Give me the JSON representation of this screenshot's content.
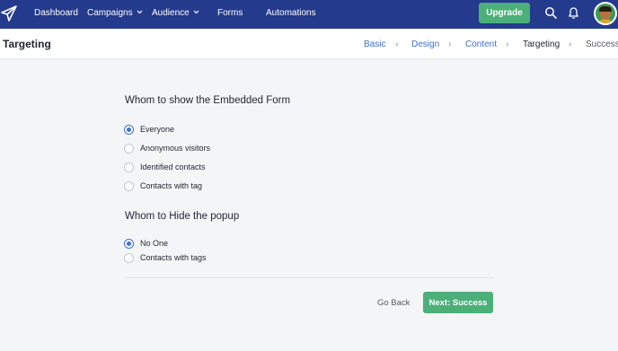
{
  "nav": {
    "items": [
      "Dashboard",
      "Campaigns",
      "Audience",
      "Forms",
      "Automations"
    ],
    "upgrade_label": "Upgrade",
    "icons": {
      "logo": "paper-plane-icon",
      "search": "search-icon",
      "bell": "bell-icon",
      "avatar": "avatar"
    },
    "colors": {
      "bar": "#243a8c",
      "accent": "#4caf7a"
    }
  },
  "header": {
    "title": "Targeting",
    "steps": [
      "Basic",
      "Design",
      "Content",
      "Targeting",
      "Success"
    ],
    "active_step": "Targeting"
  },
  "show_section": {
    "title": "Whom to show the Embedded Form",
    "options": [
      "Everyone",
      "Anonymous visitors",
      "Identified contacts",
      "Contacts with tag"
    ],
    "selected": "Everyone"
  },
  "hide_section": {
    "title": "Whom to Hide the popup",
    "options": [
      "No One",
      "Contacts with tags"
    ],
    "selected": "No One"
  },
  "footer": {
    "back_label": "Go Back",
    "next_label": "Next: Success"
  }
}
